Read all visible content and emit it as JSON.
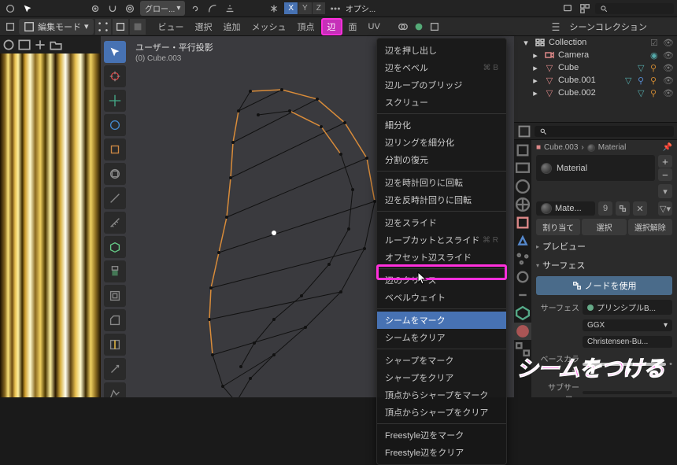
{
  "header": {
    "global_label": "グロー...",
    "axes": [
      "X",
      "Y",
      "Z"
    ],
    "option_label": "オプシ..."
  },
  "menubar": {
    "mode": "編集モード",
    "items": [
      "ビュー",
      "選択",
      "追加",
      "メッシュ",
      "頂点",
      "辺",
      "面",
      "UV"
    ],
    "highlighted_index": 5
  },
  "viewport": {
    "title": "ユーザー・平行投影",
    "subtitle": "(0) Cube.003"
  },
  "context_menu": {
    "groups": [
      [
        {
          "label": "辺を押し出し",
          "shortcut": ""
        },
        {
          "label": "辺をベベル",
          "shortcut": "⌘ B"
        },
        {
          "label": "辺ループのブリッジ",
          "shortcut": ""
        },
        {
          "label": "スクリュー",
          "shortcut": ""
        }
      ],
      [
        {
          "label": "細分化",
          "shortcut": ""
        },
        {
          "label": "辺リングを細分化",
          "shortcut": ""
        },
        {
          "label": "分割の復元",
          "shortcut": ""
        }
      ],
      [
        {
          "label": "辺を時計回りに回転",
          "shortcut": ""
        },
        {
          "label": "辺を反時計回りに回転",
          "shortcut": ""
        }
      ],
      [
        {
          "label": "辺をスライド",
          "shortcut": ""
        },
        {
          "label": "ループカットとスライド",
          "shortcut": "⌘ R"
        },
        {
          "label": "オフセット辺スライド",
          "shortcut": ""
        }
      ],
      [
        {
          "label": "辺のクリース",
          "shortcut": ""
        },
        {
          "label": "ベベルウェイト",
          "shortcut": ""
        }
      ],
      [
        {
          "label": "シームをマーク",
          "shortcut": "",
          "highlighted": true
        },
        {
          "label": "シームをクリア",
          "shortcut": ""
        }
      ],
      [
        {
          "label": "シャープをマーク",
          "shortcut": ""
        },
        {
          "label": "シャープをクリア",
          "shortcut": ""
        },
        {
          "label": "頂点からシャープをマーク",
          "shortcut": ""
        },
        {
          "label": "頂点からシャープをクリア",
          "shortcut": ""
        }
      ],
      [
        {
          "label": "Freestyle辺をマーク",
          "shortcut": ""
        },
        {
          "label": "Freestyle辺をクリア",
          "shortcut": ""
        }
      ]
    ]
  },
  "outliner": {
    "title": "シーンコレクション",
    "search_placeholder": "",
    "items": [
      {
        "name": "Collection",
        "icon": "collection"
      },
      {
        "name": "Camera",
        "icon": "camera"
      },
      {
        "name": "Cube",
        "icon": "mesh"
      },
      {
        "name": "Cube.001",
        "icon": "mesh"
      },
      {
        "name": "Cube.002",
        "icon": "mesh"
      }
    ]
  },
  "properties": {
    "breadcrumb_obj": "Cube.003",
    "breadcrumb_mat": "Material",
    "material_name": "Material",
    "mat_short": "Mate...",
    "users": "9",
    "assign": "割り当て",
    "select": "選択",
    "deselect": "選択解除",
    "panel_preview": "プレビュー",
    "panel_surface": "サーフェス",
    "use_nodes": "ノードを使用",
    "field_surface": "サーフェス",
    "val_surface": "プリンシプルB...",
    "field_ggx": "GGX",
    "field_christensen": "Christensen-Bu...",
    "field_basecolor": "ベースカラー",
    "field_subsurface": "サブサーフ..."
  },
  "annotation": "シームをつける"
}
